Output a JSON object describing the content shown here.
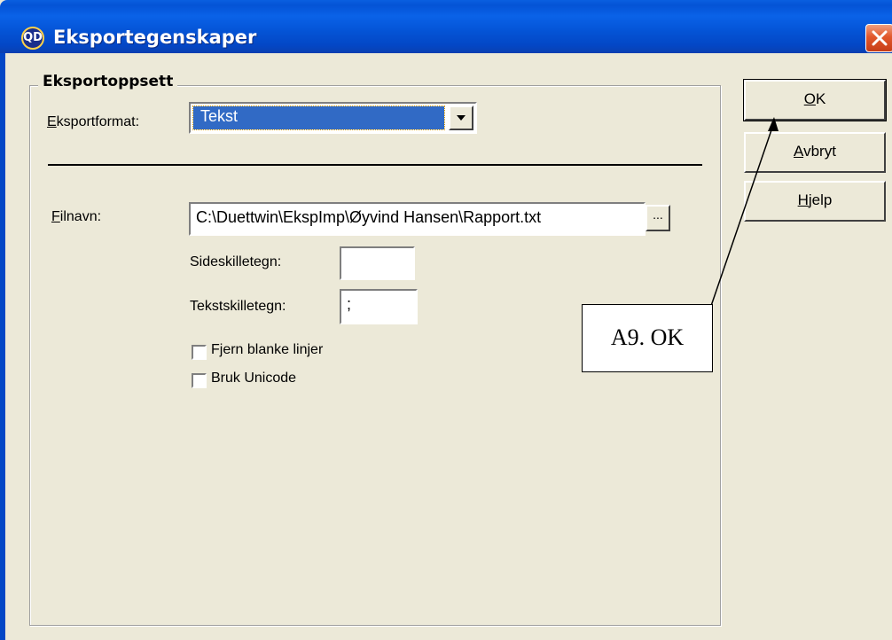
{
  "window": {
    "title": "Eksportegenskaper",
    "app_icon_text": "QD",
    "title_bar_color": "#0453d5",
    "close_button_color": "#e2582c"
  },
  "group": {
    "legend": "Eksportoppsett"
  },
  "export_format": {
    "label_mnemonic": "E",
    "label_rest": "ksportformat:",
    "selected_value": "Tekst",
    "highlight_color": "#316ac5"
  },
  "filename": {
    "label_mnemonic": "F",
    "label_rest": "ilnavn:",
    "value": "C:\\Duettwin\\EkspImp\\Øyvind Hansen\\Rapport.txt",
    "browse_label": "..."
  },
  "page_separator": {
    "label": "Sideskilletegn:",
    "value": ""
  },
  "text_separator": {
    "label": "Tekstskilletegn:",
    "value": ";"
  },
  "options": [
    {
      "label": "Fjern blanke linjer",
      "checked": false
    },
    {
      "label": "Bruk Unicode",
      "checked": false
    }
  ],
  "buttons": {
    "ok_mnemonic": "O",
    "ok_rest": "K",
    "cancel_mnemonic": "A",
    "cancel_rest": "vbryt",
    "help_mnemonic": "H",
    "help_rest": "jelp"
  },
  "annotation": {
    "label": "A9. OK"
  }
}
